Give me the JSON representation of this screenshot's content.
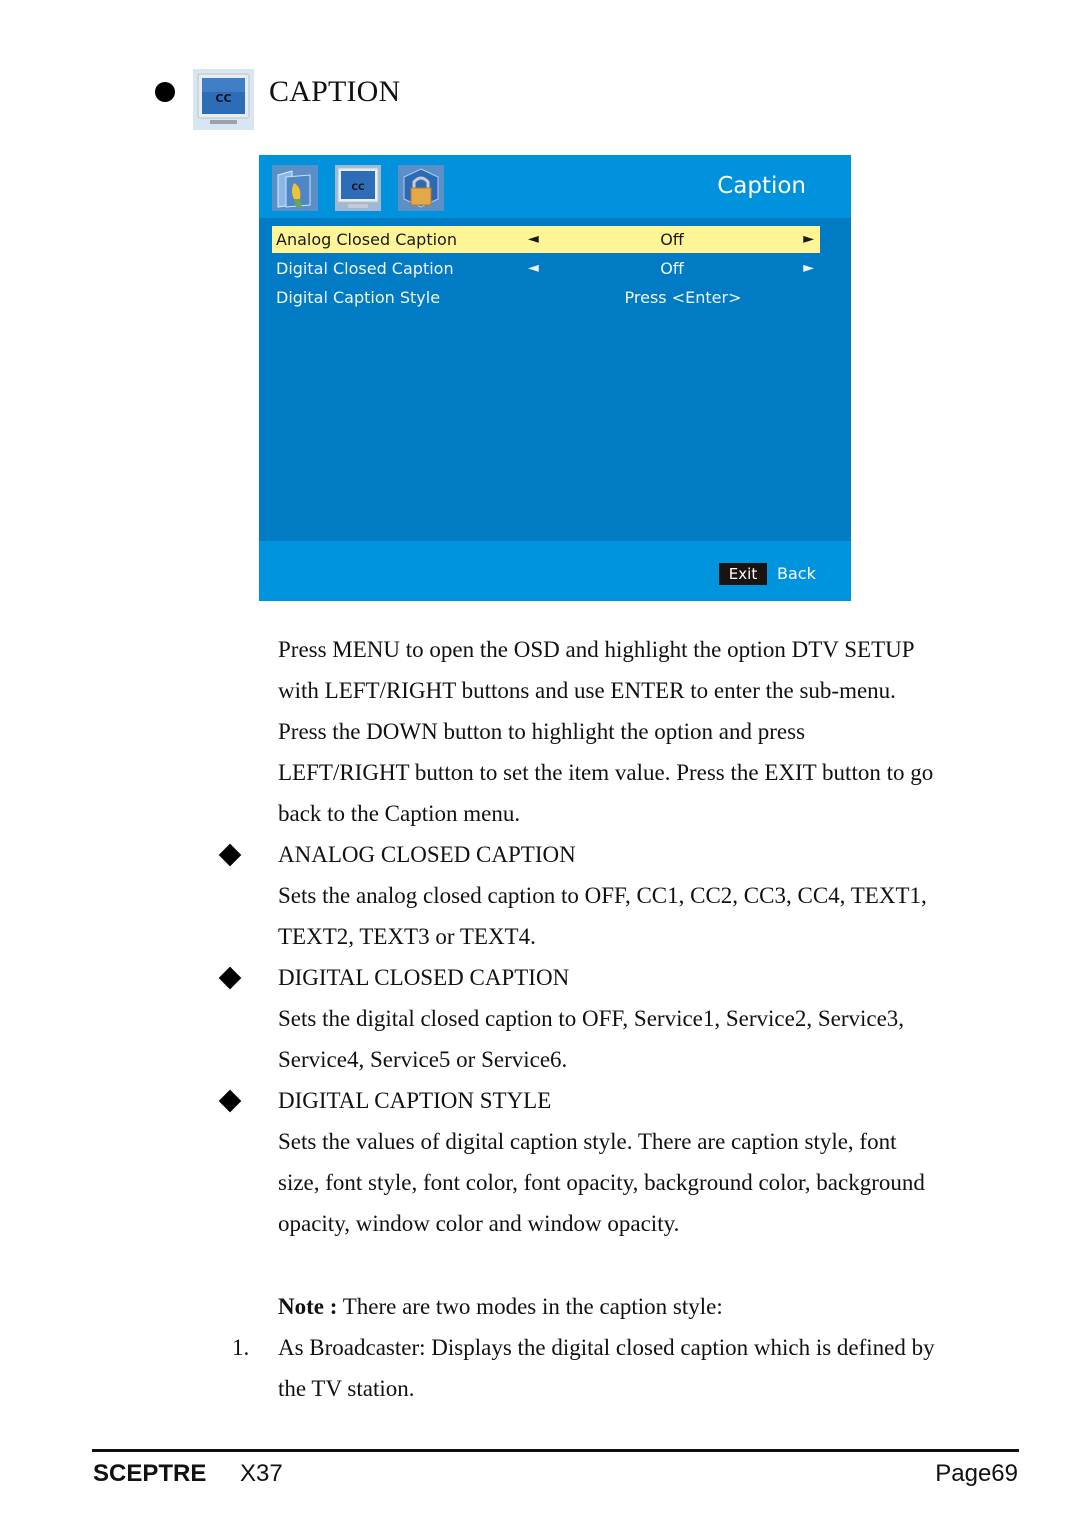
{
  "section": {
    "icon": "closed-caption-monitor-icon",
    "title": "CAPTION"
  },
  "osd": {
    "title": "Caption",
    "tabs": [
      {
        "icon": "folder-pen-icon",
        "label": "Setup"
      },
      {
        "icon": "closed-caption-monitor-icon",
        "label": "Caption"
      },
      {
        "icon": "padlock-cube-icon",
        "label": "Lock"
      }
    ],
    "rows": [
      {
        "label": "Analog Closed Caption",
        "left_arrow": "◄",
        "value": "Off",
        "right_arrow": "►",
        "selected": true
      },
      {
        "label": "Digital Closed Caption",
        "left_arrow": "◄",
        "value": "Off",
        "right_arrow": "►",
        "selected": false
      },
      {
        "label": "Digital Caption Style",
        "value": "Press <Enter>",
        "selected": false
      }
    ],
    "footer": {
      "exit_label": "Exit",
      "back_label": "Back"
    },
    "colors": {
      "panel": "#007bc4",
      "header": "#0092dc",
      "footer": "#0094de",
      "highlight": "#fff596"
    }
  },
  "body": {
    "intro": [
      "Press MENU to open the OSD and highlight the option DTV SETUP",
      "with LEFT/RIGHT buttons and use ENTER to enter the sub-menu.",
      "Press the DOWN button to highlight the option and press",
      "LEFT/RIGHT button to set the item value. Press the EXIT button to go",
      "back to the Caption menu."
    ],
    "items": [
      {
        "heading": "ANALOG CLOSED CAPTION",
        "text": [
          "Sets the analog closed caption to OFF, CC1, CC2, CC3, CC4, TEXT1,",
          "TEXT2, TEXT3 or TEXT4."
        ]
      },
      {
        "heading": "DIGITAL CLOSED CAPTION",
        "text": [
          "Sets the digital closed caption to OFF, Service1, Service2, Service3,",
          "Service4, Service5 or Service6."
        ]
      },
      {
        "heading": "DIGITAL CAPTION STYLE",
        "text": [
          "Sets the values of digital caption style. There are caption style, font",
          "size, font style, font color, font opacity, background color, background",
          "opacity, window color and window opacity."
        ]
      }
    ],
    "note": {
      "label": "Note :",
      "text": " There are two modes in the caption style:"
    },
    "numbered": [
      {
        "num": "1.",
        "text": [
          "As Broadcaster: Displays the digital closed caption which is defined by",
          "the TV station."
        ]
      }
    ]
  },
  "footer": {
    "brand": "SCEPTRE",
    "model": "X37",
    "page": "Page69"
  }
}
